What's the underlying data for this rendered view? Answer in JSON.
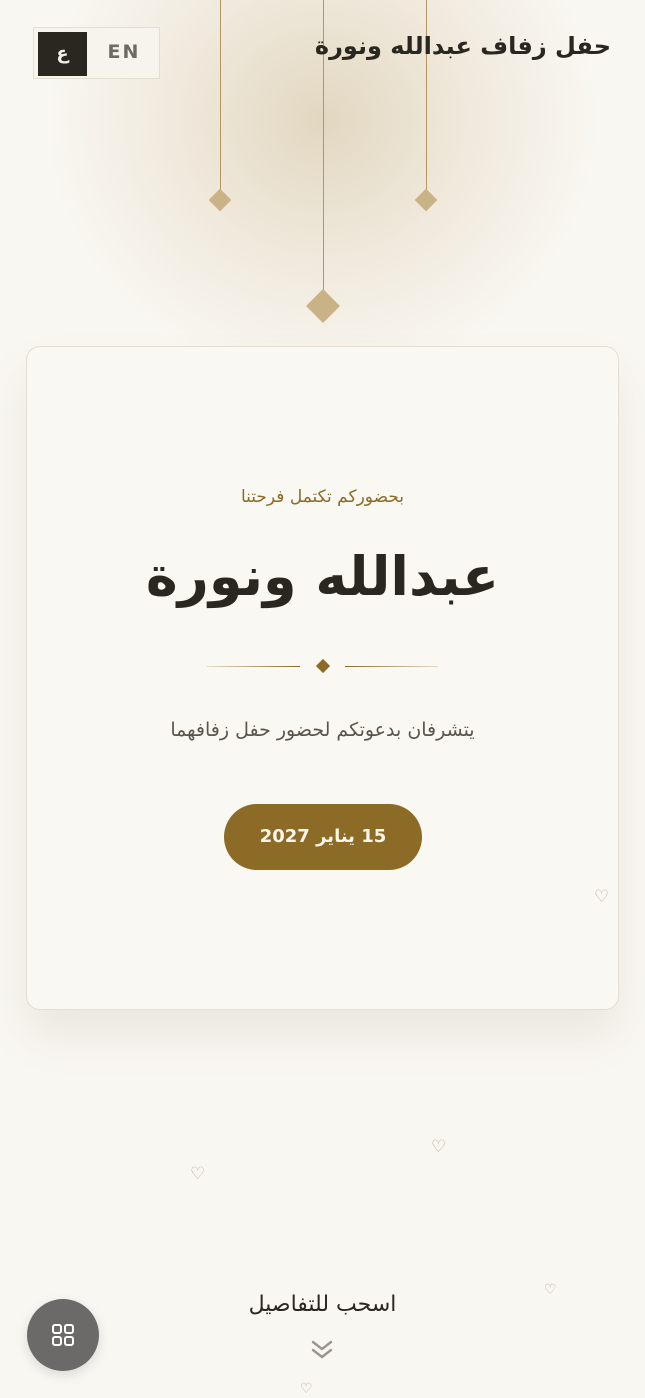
{
  "header": {
    "title": "حفل زفاف عبدالله ونورة",
    "language_switch": {
      "active": "ع",
      "inactive": "EN"
    }
  },
  "hero": {
    "tagline": "بحضوركم تكتمل فرحتنا",
    "couple_names": "عبدالله ونورة",
    "invitation_text": "يتشرفان بدعوتكم لحضور حفل زفافهما",
    "date": "15 يناير 2027"
  },
  "footer": {
    "swipe_hint": "اسحب  للتفاصيل"
  },
  "icons": {
    "lantern": "diamond-lantern-icon",
    "heart": "heart-outline-icon",
    "chevrons": "double-chevron-down-icon",
    "menu": "grid-menu-icon"
  },
  "colors": {
    "accent": "#8b6b26",
    "text_dark": "#2a2620",
    "background": "#f9f7f2"
  }
}
